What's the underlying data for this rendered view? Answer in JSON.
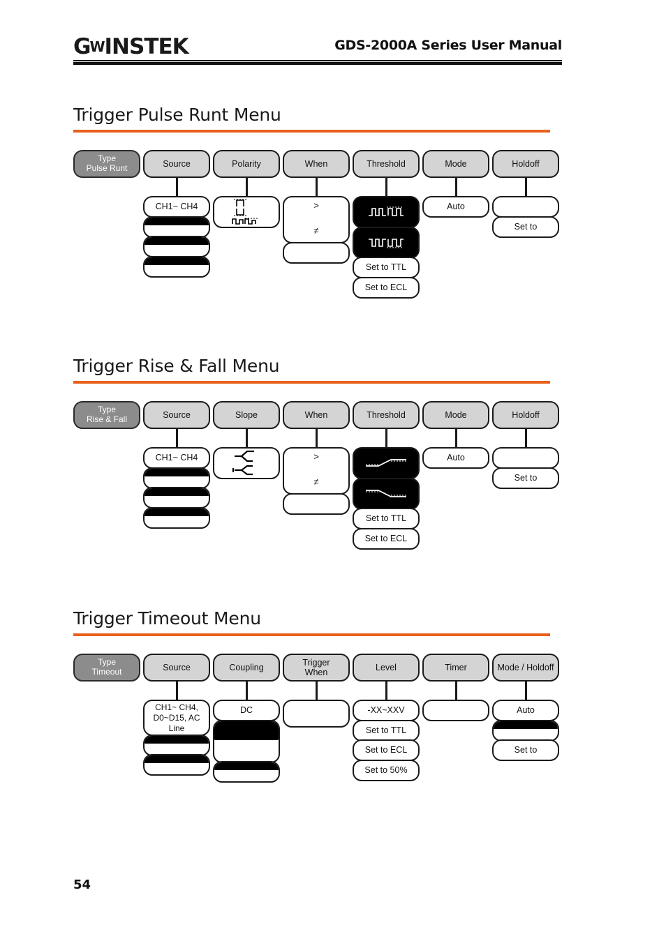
{
  "header": {
    "logo_gw": "G",
    "logo_w": "W",
    "logo_instek": "INSTEK",
    "manual_title": "GDS-2000A Series User Manual"
  },
  "page_number": "54",
  "sections": [
    {
      "title": "Trigger Pulse Runt Menu",
      "heads": [
        {
          "label": "Type\nPulse Runt",
          "type": true
        },
        {
          "label": "Source"
        },
        {
          "label": "Polarity"
        },
        {
          "label": "When"
        },
        {
          "label": "Threshold"
        },
        {
          "label": "Mode"
        },
        {
          "label": "Holdoff"
        }
      ],
      "columns": [
        {
          "items": []
        },
        {
          "items": [
            {
              "label": "CH1~ CH4"
            },
            {
              "label": "",
              "style": "halfblack"
            },
            {
              "label": "",
              "style": "halfblack"
            },
            {
              "label": "",
              "style": "halfblack"
            }
          ]
        },
        {
          "items": [
            {
              "label": "",
              "style": "icon",
              "icon": "pulse-polarity-icon"
            }
          ]
        },
        {
          "items": [
            {
              "label": "",
              "style": "when",
              "top": ">",
              "bottom": "≠"
            },
            {
              "label": "",
              "style": "empty"
            }
          ]
        },
        {
          "items": [
            {
              "label": "",
              "style": "icon-black",
              "icon": "runt-waveform-high-icon"
            },
            {
              "label": "",
              "style": "icon-black",
              "icon": "runt-waveform-low-icon"
            },
            {
              "label": "Set to TTL"
            },
            {
              "label": "Set to ECL"
            }
          ]
        },
        {
          "items": [
            {
              "label": "Auto"
            }
          ]
        },
        {
          "items": [
            {
              "label": ""
            },
            {
              "label": "Set to"
            }
          ]
        }
      ]
    },
    {
      "title": "Trigger Rise & Fall Menu",
      "heads": [
        {
          "label": "Type\nRise & Fall",
          "type": true
        },
        {
          "label": "Source"
        },
        {
          "label": "Slope"
        },
        {
          "label": "When"
        },
        {
          "label": "Threshold"
        },
        {
          "label": "Mode"
        },
        {
          "label": "Holdoff"
        }
      ],
      "columns": [
        {
          "items": []
        },
        {
          "items": [
            {
              "label": "CH1~ CH4"
            },
            {
              "label": "",
              "style": "halfblack"
            },
            {
              "label": "",
              "style": "halfblack"
            },
            {
              "label": "",
              "style": "halfblack"
            }
          ]
        },
        {
          "items": [
            {
              "label": "",
              "style": "icon",
              "icon": "slope-rise-fall-icon"
            }
          ]
        },
        {
          "items": [
            {
              "label": "",
              "style": "when",
              "top": ">",
              "bottom": "≠"
            },
            {
              "label": "",
              "style": "empty"
            }
          ]
        },
        {
          "items": [
            {
              "label": "",
              "style": "icon-black",
              "icon": "ramp-rising-icon"
            },
            {
              "label": "",
              "style": "icon-black",
              "icon": "ramp-falling-icon"
            },
            {
              "label": "Set to TTL"
            },
            {
              "label": "Set to ECL"
            }
          ]
        },
        {
          "items": [
            {
              "label": "Auto"
            }
          ]
        },
        {
          "items": [
            {
              "label": ""
            },
            {
              "label": "Set to"
            }
          ]
        }
      ]
    },
    {
      "title": "Trigger Timeout Menu",
      "heads": [
        {
          "label": "Type\nTimeout",
          "type": true
        },
        {
          "label": "Source"
        },
        {
          "label": "Coupling"
        },
        {
          "label": "Trigger\nWhen"
        },
        {
          "label": "Level"
        },
        {
          "label": "Timer"
        },
        {
          "label": "Mode / Holdoff"
        }
      ],
      "columns": [
        {
          "items": []
        },
        {
          "items": [
            {
              "label": "CH1~ CH4,\nD0~D15, AC\nLine",
              "style": "multiline"
            },
            {
              "label": "",
              "style": "halfblack"
            },
            {
              "label": "",
              "style": "halfblack"
            }
          ]
        },
        {
          "items": [
            {
              "label": "DC"
            },
            {
              "label": "",
              "style": "halfblack-tall"
            },
            {
              "label": "",
              "style": "halfblack"
            }
          ]
        },
        {
          "items": [
            {
              "label": "",
              "style": "empty-tall"
            }
          ]
        },
        {
          "items": [
            {
              "label": "-XX~XXV"
            },
            {
              "label": "Set to TTL"
            },
            {
              "label": "Set to ECL"
            },
            {
              "label": "Set to 50%"
            }
          ]
        },
        {
          "items": [
            {
              "label": ""
            }
          ]
        },
        {
          "items": [
            {
              "label": "Auto"
            },
            {
              "label": "",
              "style": "halfblack"
            },
            {
              "label": "Set to"
            }
          ]
        }
      ]
    }
  ]
}
